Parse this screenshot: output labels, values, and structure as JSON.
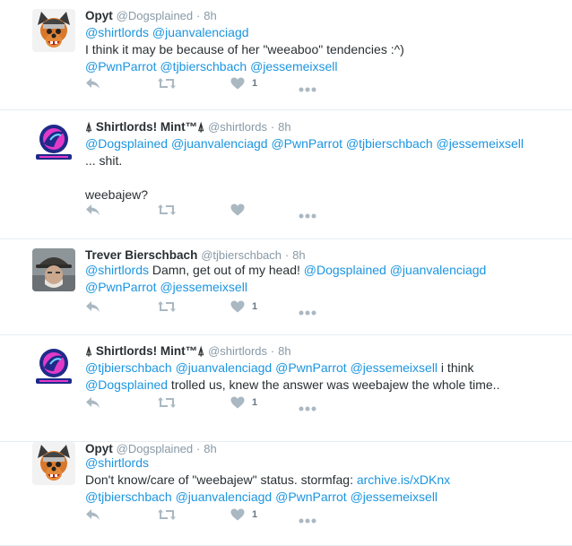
{
  "colors": {
    "mention": "#1b95e0",
    "icon": "#aab8c2",
    "muted": "#8899a6"
  },
  "tweets": [
    {
      "avatar": "dog-avatar-icon",
      "name": "Opyt",
      "handle": "@Dogsplained",
      "dot": "·",
      "time": "8h",
      "lines": [
        [
          {
            "t": "@shirtlords",
            "m": true
          },
          {
            "t": " ",
            "m": false
          },
          {
            "t": "@juanvalenciagd",
            "m": true
          }
        ],
        [
          {
            "t": "I think it may be because of her \"weeaboo\" tendencies :^)",
            "m": false
          }
        ],
        [
          {
            "t": "@PwnParrot",
            "m": true
          },
          {
            "t": " ",
            "m": false
          },
          {
            "t": "@tjbierschbach",
            "m": true
          },
          {
            "t": " ",
            "m": false
          },
          {
            "t": "@jessemeixsell",
            "m": true
          }
        ]
      ],
      "like_count": "1"
    },
    {
      "avatar": "shirtlords-avatar-icon",
      "name": "⍋ Shirtlords! Mint™⍋",
      "handle": "@shirtlords",
      "dot": "·",
      "time": "8h",
      "lines": [
        [
          {
            "t": "@Dogsplained",
            "m": true
          },
          {
            "t": " ",
            "m": false
          },
          {
            "t": "@juanvalenciagd",
            "m": true
          },
          {
            "t": " ",
            "m": false
          },
          {
            "t": "@PwnParrot",
            "m": true
          },
          {
            "t": " ",
            "m": false
          },
          {
            "t": "@tjbierschbach",
            "m": true
          },
          {
            "t": " ",
            "m": false
          },
          {
            "t": "@jessemeixsell",
            "m": true
          }
        ],
        [
          {
            "t": "... shit.",
            "m": false
          }
        ],
        [],
        [
          {
            "t": "weebajew?",
            "m": false
          }
        ]
      ],
      "like_count": ""
    },
    {
      "avatar": "trever-avatar-icon",
      "name": "Trever Bierschbach",
      "handle": "@tjbierschbach",
      "dot": "·",
      "time": "8h",
      "lines": [
        [
          {
            "t": "@shirtlords",
            "m": true
          },
          {
            "t": " Damn, get out of my head! ",
            "m": false
          },
          {
            "t": "@Dogsplained",
            "m": true
          },
          {
            "t": " ",
            "m": false
          },
          {
            "t": "@juanvalenciagd",
            "m": true
          }
        ],
        [
          {
            "t": "@PwnParrot",
            "m": true
          },
          {
            "t": " ",
            "m": false
          },
          {
            "t": "@jessemeixsell",
            "m": true
          }
        ]
      ],
      "like_count": "1"
    },
    {
      "avatar": "shirtlords-avatar-icon",
      "name": "⍋ Shirtlords! Mint™⍋",
      "handle": "@shirtlords",
      "dot": "·",
      "time": "8h",
      "lines": [
        [
          {
            "t": "@tjbierschbach",
            "m": true
          },
          {
            "t": " ",
            "m": false
          },
          {
            "t": "@juanvalenciagd",
            "m": true
          },
          {
            "t": " ",
            "m": false
          },
          {
            "t": "@PwnParrot",
            "m": true
          },
          {
            "t": " ",
            "m": false
          },
          {
            "t": "@jessemeixsell",
            "m": true
          },
          {
            "t": " i think",
            "m": false
          }
        ],
        [
          {
            "t": "@Dogsplained",
            "m": true
          },
          {
            "t": " trolled us, knew the answer was weebajew the whole time..",
            "m": false
          }
        ]
      ],
      "like_count": "1"
    },
    {
      "avatar": "dog-avatar-icon",
      "name": "Opyt",
      "handle": "@Dogsplained",
      "dot": "·",
      "time": "8h",
      "lines": [
        [
          {
            "t": "@shirtlords",
            "m": true
          }
        ],
        [
          {
            "t": "Don't know/care of \"weebajew\" status. stormfag: ",
            "m": false
          },
          {
            "t": "archive.is/xDKnx",
            "m": true
          }
        ],
        [
          {
            "t": "@tjbierschbach",
            "m": true
          },
          {
            "t": " ",
            "m": false
          },
          {
            "t": "@juanvalenciagd",
            "m": true
          },
          {
            "t": " ",
            "m": false
          },
          {
            "t": "@PwnParrot",
            "m": true
          },
          {
            "t": " ",
            "m": false
          },
          {
            "t": "@jessemeixsell",
            "m": true
          }
        ]
      ],
      "like_count": "1"
    }
  ]
}
